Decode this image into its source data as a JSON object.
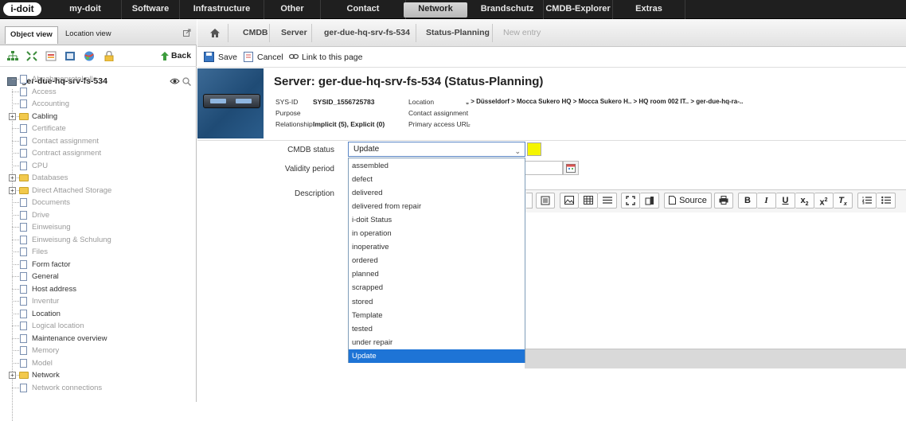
{
  "topnav": {
    "logo": "i-doit",
    "items": [
      "my-doit",
      "Software",
      "Infrastructure",
      "Other",
      "Contact",
      "Network",
      "Brandschutz",
      "CMDB-Explorer",
      "Extras"
    ],
    "active_index": 5
  },
  "left": {
    "tabs": [
      "Object view",
      "Location view"
    ],
    "back_label": "Back",
    "root": "ger-due-hq-srv-fs-534",
    "items": [
      {
        "label": "Abnahmeprotokolle",
        "type": "doc",
        "style": "muted"
      },
      {
        "label": "Access",
        "type": "doc",
        "style": "muted"
      },
      {
        "label": "Accounting",
        "type": "doc",
        "style": "muted"
      },
      {
        "label": "Cabling",
        "type": "folder",
        "style": "dark"
      },
      {
        "label": "Certificate",
        "type": "doc",
        "style": "muted"
      },
      {
        "label": "Contact assignment",
        "type": "doc",
        "style": "muted"
      },
      {
        "label": "Contract assignment",
        "type": "doc",
        "style": "muted"
      },
      {
        "label": "CPU",
        "type": "doc",
        "style": "muted"
      },
      {
        "label": "Databases",
        "type": "folder",
        "style": "muted"
      },
      {
        "label": "Direct Attached Storage",
        "type": "folder",
        "style": "muted"
      },
      {
        "label": "Documents",
        "type": "doc",
        "style": "muted"
      },
      {
        "label": "Drive",
        "type": "doc",
        "style": "muted"
      },
      {
        "label": "Einweisung",
        "type": "doc",
        "style": "muted"
      },
      {
        "label": "Einweisung & Schulung",
        "type": "doc",
        "style": "muted"
      },
      {
        "label": "Files",
        "type": "doc",
        "style": "muted"
      },
      {
        "label": "Form factor",
        "type": "doc",
        "style": "dark"
      },
      {
        "label": "General",
        "type": "doc",
        "style": "dark"
      },
      {
        "label": "Host address",
        "type": "doc",
        "style": "dark"
      },
      {
        "label": "Inventur",
        "type": "doc",
        "style": "muted"
      },
      {
        "label": "Location",
        "type": "doc",
        "style": "dark"
      },
      {
        "label": "Logical location",
        "type": "doc",
        "style": "muted"
      },
      {
        "label": "Maintenance overview",
        "type": "doc",
        "style": "dark"
      },
      {
        "label": "Memory",
        "type": "doc",
        "style": "muted"
      },
      {
        "label": "Model",
        "type": "doc",
        "style": "muted"
      },
      {
        "label": "Network",
        "type": "folder",
        "style": "dark"
      },
      {
        "label": "Network connections",
        "type": "doc",
        "style": "muted"
      }
    ]
  },
  "breadcrumb": [
    "CMDB",
    "Server",
    "ger-due-hq-srv-fs-534",
    "Status-Planning",
    "New entry"
  ],
  "actions": {
    "save": "Save",
    "cancel": "Cancel",
    "link": "Link to this page"
  },
  "object": {
    "title": "Server: ger-due-hq-srv-fs-534 (Status-Planning)",
    "sysid_label": "SYS-ID",
    "sysid": "SYSID_1556725783",
    "purpose_label": "Purpose",
    "relationship_label": "Relationship",
    "relationship": "Implicit (5), Explicit (0)",
    "location_label": "Location",
    "location": "„ > Düsseldorf > Mocca Sukero HQ > Mocca Sukero H.. > HQ room 002 IT.. > ger-due-hq-ra-..",
    "contact_label": "Contact assignment",
    "access_label": "Primary access URL",
    "access": "-"
  },
  "form": {
    "cmdb_status_label": "CMDB status",
    "cmdb_status_value": "Update",
    "validity_label": "Validity period",
    "description_label": "Description",
    "status_color": "#f5f500",
    "options": [
      "assembled",
      "defect",
      "delivered",
      "delivered from repair",
      "i-doit Status",
      "in operation",
      "inoperative",
      "ordered",
      "planned",
      "scrapped",
      "stored",
      "Template",
      "tested",
      "under repair",
      "Update"
    ],
    "selected_index": 14,
    "source_label": "Source"
  },
  "colors": {
    "nav_bg": "#1f1f1f",
    "selection": "#1e74d6",
    "header_image": "#2b5d8c"
  }
}
